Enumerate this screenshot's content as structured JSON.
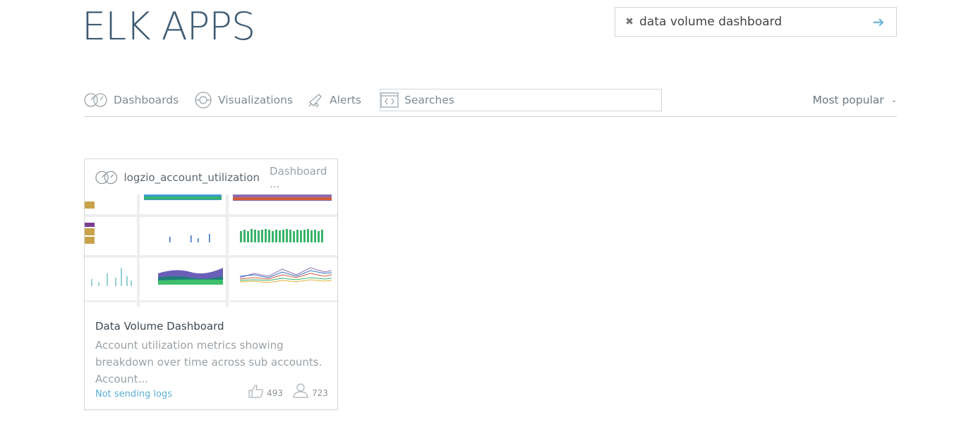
{
  "brand": {
    "title": "ELK APPS"
  },
  "search": {
    "value": "data volume dashboard"
  },
  "tabs": [
    {
      "label": "Dashboards",
      "icon": "dashboard-icon"
    },
    {
      "label": "Visualizations",
      "icon": "visualization-icon"
    },
    {
      "label": "Alerts",
      "icon": "alert-icon"
    },
    {
      "label": "Searches",
      "icon": "code-icon"
    }
  ],
  "sort": {
    "label": "Most popular"
  },
  "card": {
    "account": "logzio_account_utilization",
    "kind": "Dashboard ...",
    "title": "Data Volume Dashboard",
    "description": "Account utilization metrics showing breakdown over time across sub accounts. Account...",
    "status": "Not sending logs",
    "likes": "493",
    "users": "723"
  },
  "colors": {
    "accent": "#5aaed6",
    "brand": "#3d5a73"
  }
}
